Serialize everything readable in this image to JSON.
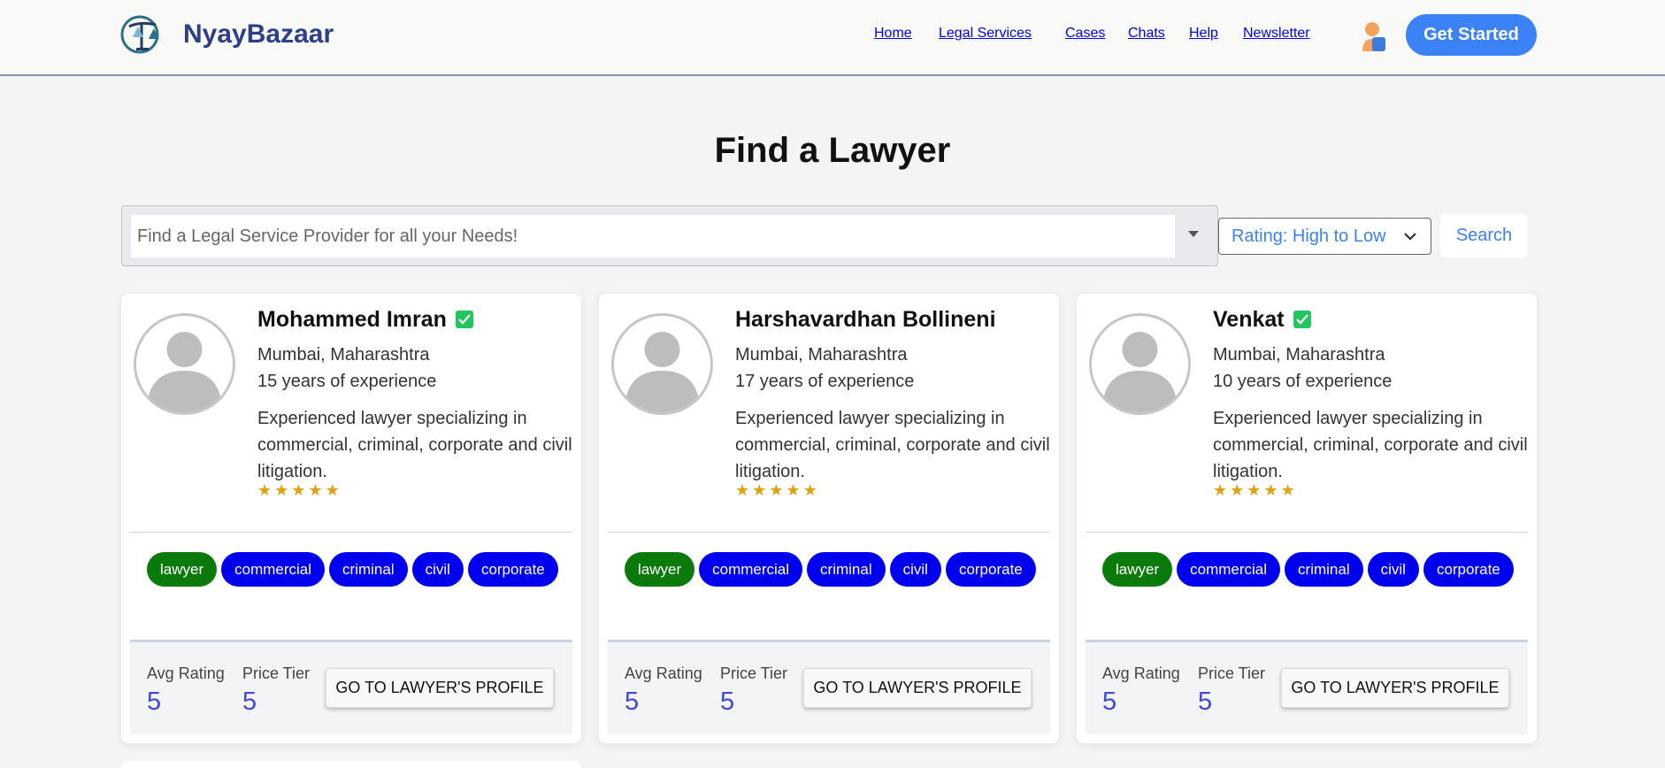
{
  "header": {
    "brand": "NyayBazaar",
    "nav": [
      "Home",
      "Legal Services",
      "Cases",
      "Chats",
      "Help",
      "Newsletter"
    ],
    "cta_label": "Get Started"
  },
  "page": {
    "title": "Find a Lawyer"
  },
  "search": {
    "placeholder": "Find a Legal Service Provider for all your Needs!",
    "sort_label": "Rating: High to Low",
    "button_label": "Search"
  },
  "lawyers": [
    {
      "name": "Mohammed Imran",
      "verified": true,
      "location": "Mumbai, Maharashtra",
      "experience": "15 years of experience",
      "description": "Experienced lawyer specializing in commercial, criminal, corporate and civil litigation.",
      "stars": 5,
      "tags": [
        "lawyer",
        "commercial",
        "criminal",
        "civil",
        "corporate"
      ],
      "avg_rating_label": "Avg Rating",
      "avg_rating": "5",
      "price_tier_label": "Price Tier",
      "price_tier": "5",
      "profile_button": "GO TO LAWYER'S PROFILE"
    },
    {
      "name": "Harshavardhan Bollineni",
      "verified": false,
      "location": "Mumbai, Maharashtra",
      "experience": "17 years of experience",
      "description": "Experienced lawyer specializing in commercial, criminal, corporate and civil litigation.",
      "stars": 5,
      "tags": [
        "lawyer",
        "commercial",
        "criminal",
        "civil",
        "corporate"
      ],
      "avg_rating_label": "Avg Rating",
      "avg_rating": "5",
      "price_tier_label": "Price Tier",
      "price_tier": "5",
      "profile_button": "GO TO LAWYER'S PROFILE"
    },
    {
      "name": "Venkat",
      "verified": true,
      "location": "Mumbai, Maharashtra",
      "experience": "10 years of experience",
      "description": "Experienced lawyer specializing in commercial, criminal, corporate and civil litigation.",
      "stars": 5,
      "tags": [
        "lawyer",
        "commercial",
        "criminal",
        "civil",
        "corporate"
      ],
      "avg_rating_label": "Avg Rating",
      "avg_rating": "5",
      "price_tier_label": "Price Tier",
      "price_tier": "5",
      "profile_button": "GO TO LAWYER'S PROFILE"
    }
  ],
  "colors": {
    "primary": "#3b82f6",
    "brand": "#2b3f8a",
    "tag_blue": "#0000ee",
    "tag_green": "#0a7a0a",
    "verified_green": "#22c55e",
    "star": "#e0a10c",
    "rating_value": "#4346d8"
  },
  "icons": {
    "logo": "scales-of-justice-logo",
    "user": "user-icon",
    "verified": "check-badge-icon",
    "star": "star-icon",
    "sort": "chevron-down-icon",
    "dropdown": "caret-down-icon"
  }
}
